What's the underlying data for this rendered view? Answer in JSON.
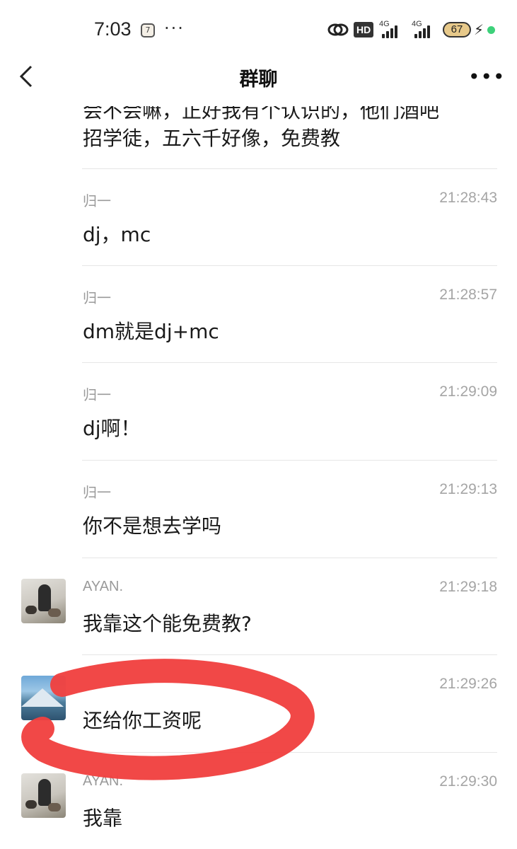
{
  "status_bar": {
    "time": "7:03",
    "clock_icon_text": "7",
    "dots": "···",
    "hd_label": "HD",
    "sim1_label": "4G",
    "sim2_label": "4G",
    "battery": "67",
    "icons": [
      "clock-icon",
      "link-icon",
      "signal-icon",
      "battery-icon",
      "charging-bolt-icon"
    ]
  },
  "nav": {
    "title": "群聊",
    "back_icon": "chevron-left-icon",
    "more_label": "•••"
  },
  "partial_message": {
    "line1": "会不会嘛，正好我有个认识的，他们酒吧",
    "line2": "招学徒，五六千好像，免费教"
  },
  "messages": [
    {
      "sender": "归一",
      "time": "21:28:43",
      "text": "dj，mc",
      "avatar": ""
    },
    {
      "sender": "归一",
      "time": "21:28:57",
      "text": "dm就是dj+mc",
      "avatar": ""
    },
    {
      "sender": "归一",
      "time": "21:29:09",
      "text": "dj啊！",
      "avatar": ""
    },
    {
      "sender": "归一",
      "time": "21:29:13",
      "text": "你不是想去学吗",
      "avatar": ""
    },
    {
      "sender": "AYAN.",
      "time": "21:29:18",
      "text": "我靠这个能免费教?",
      "avatar": "ayan"
    },
    {
      "sender": "",
      "time": "21:29:26",
      "text": "还给你工资呢",
      "avatar": "scene"
    },
    {
      "sender": "AYAN.",
      "time": "21:29:30",
      "text": "我靠",
      "avatar": "ayan"
    }
  ],
  "annotation": {
    "color": "#f0413f"
  },
  "colors": {
    "text": "#1a1a1a",
    "meta": "#a5a5a5",
    "divider": "#e6e6e6",
    "accent_dot": "#3dd17a"
  }
}
